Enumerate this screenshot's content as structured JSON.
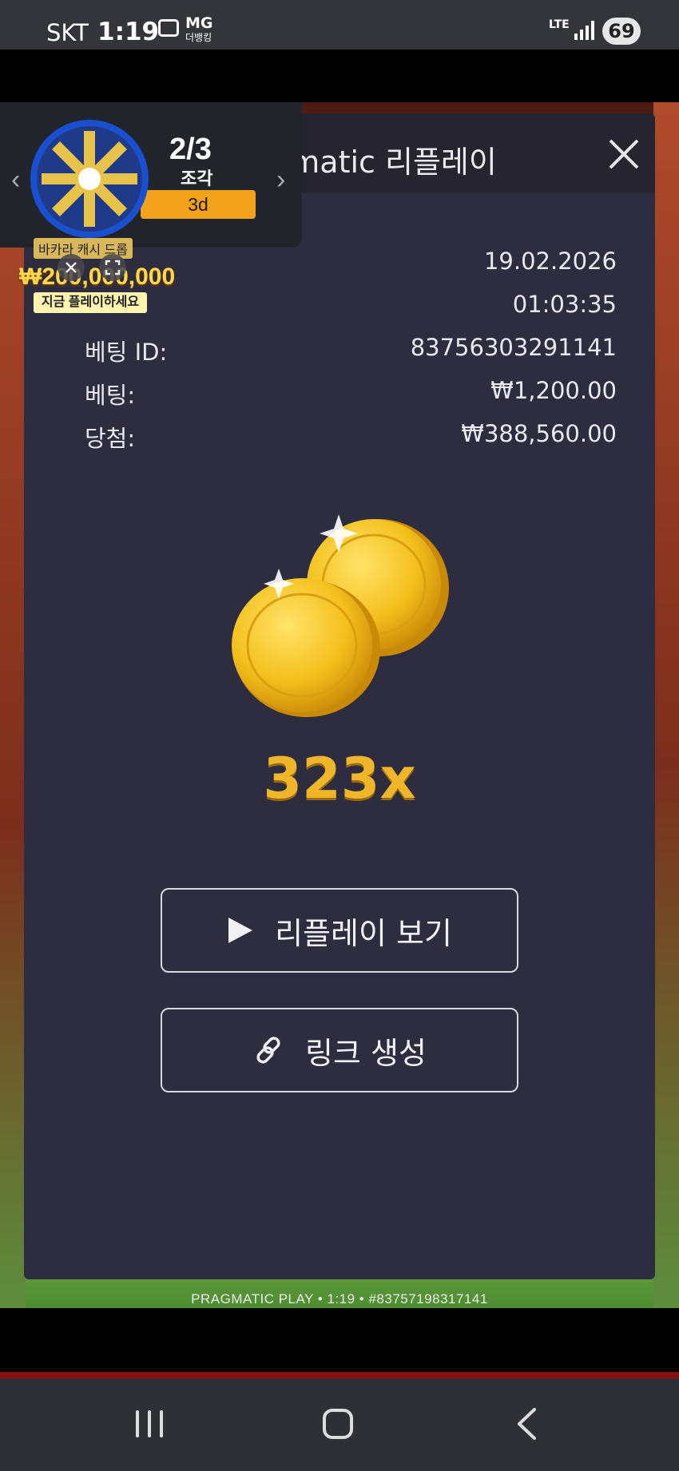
{
  "status_bar": {
    "carrier": "SKT",
    "time": "1:19",
    "app_badge": "MG",
    "app_badge_sub": "더뱅킹",
    "network": "LTE",
    "battery": "69"
  },
  "dialog": {
    "title": "Pragmatic 리플레이",
    "info_rows": [
      {
        "label": "",
        "value": "19.02.2026"
      },
      {
        "label": "",
        "value": "01:03:35"
      },
      {
        "label": "베팅 ID:",
        "value": "83756303291141"
      },
      {
        "label": "베팅:",
        "value": "₩1,200.00"
      },
      {
        "label": "당첨:",
        "value": "₩388,560.00"
      }
    ],
    "multiplier": "323x",
    "buttons": {
      "replay": "리플레이 보기",
      "link": "링크 생성"
    }
  },
  "promo": {
    "count": "2/3",
    "count_label": "조각",
    "badge": "3d",
    "wheel_name": "바카라 캐시 드롭",
    "wheel_amount": "₩200,000,000",
    "wheel_cta": "지금 플레이하세요"
  },
  "game_footer": "PRAGMATIC PLAY • 1:19 • #83757198317141"
}
